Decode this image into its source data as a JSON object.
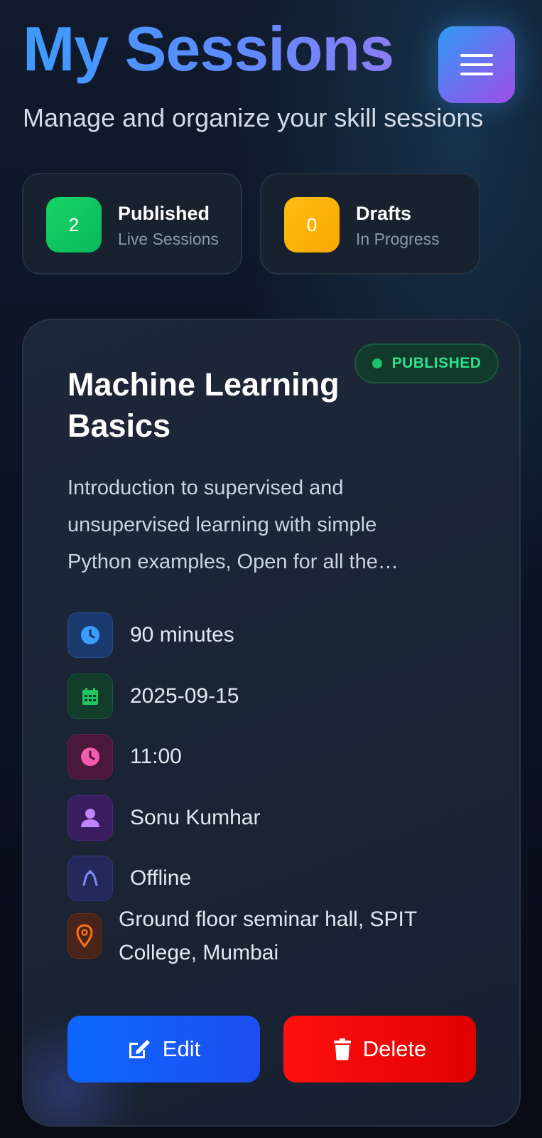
{
  "header": {
    "title": "My Sessions",
    "subtitle": "Manage and organize your skill sessions",
    "menu_icon": "hamburger-menu-icon"
  },
  "stats": {
    "published": {
      "count": "2",
      "label": "Published",
      "sub": "Live Sessions",
      "color": "#16d468"
    },
    "drafts": {
      "count": "0",
      "label": "Drafts",
      "sub": "In Progress",
      "color": "#ffb300"
    }
  },
  "session": {
    "status": "PUBLISHED",
    "status_color": "#2ee08a",
    "title": "Machine Learning Basics",
    "description": "Introduction to supervised and unsupervised learning with simple Python examples, Open for all the…",
    "details": {
      "duration": {
        "icon": "clock-icon",
        "text": "90 minutes",
        "color": "#3b9cff"
      },
      "date": {
        "icon": "calendar-icon",
        "text": "2025-09-15",
        "color": "#22c55e"
      },
      "time": {
        "icon": "clock-icon",
        "text": "11:00",
        "color": "#f25bb0"
      },
      "host": {
        "icon": "user-icon",
        "text": "Sonu Kumhar",
        "color": "#c084fc"
      },
      "mode": {
        "icon": "mode-icon",
        "text": "Offline",
        "color": "#818cf8"
      },
      "location": {
        "icon": "map-pin-icon",
        "text": "Ground floor seminar hall, SPIT College, Mumbai",
        "color": "#f97316"
      }
    },
    "actions": {
      "edit_label": "Edit",
      "delete_label": "Delete"
    }
  }
}
